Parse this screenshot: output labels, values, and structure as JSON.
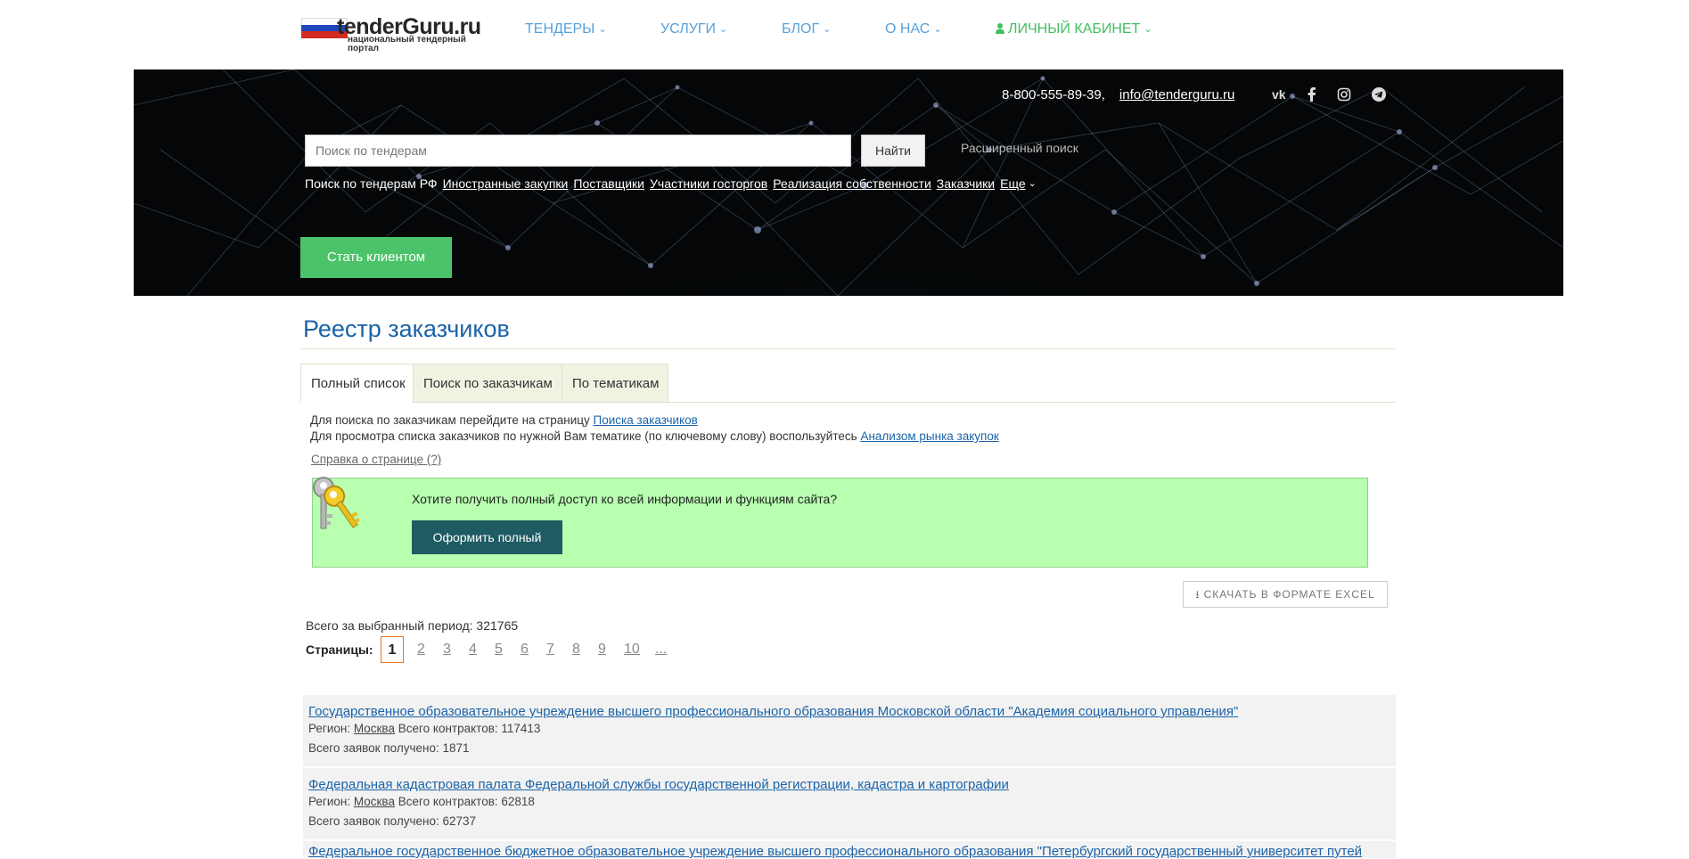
{
  "header": {
    "logo_text": "tenderGuru.ru",
    "logo_sub": "национальный тендерный портал",
    "nav": [
      {
        "label": "ТЕНДЕРЫ"
      },
      {
        "label": "УСЛУГИ"
      },
      {
        "label": "БЛОГ"
      },
      {
        "label": "О НАС"
      },
      {
        "label": "ЛИЧНЫЙ КАБИНЕТ"
      }
    ]
  },
  "hero": {
    "phone": "8-800-555-89-39,",
    "email": "info@tenderguru.ru",
    "social_icons": [
      "vk-icon",
      "facebook-icon",
      "instagram-icon",
      "telegram-icon"
    ],
    "search_placeholder": "Поиск по тендерам",
    "search_button": "Найти",
    "advanced_search": "Расширенный поиск",
    "quick_prefix": "Поиск по тендерам РФ",
    "quick_links": [
      "Иностранные закупки",
      "Поставщики",
      "Участники госторгов",
      "Реализация собственности",
      "Заказчики",
      "Еще"
    ],
    "client_button": "Стать клиентом"
  },
  "main": {
    "title": "Реестр заказчиков",
    "tabs": [
      {
        "label": "Полный список",
        "active": true
      },
      {
        "label": "Поиск по заказчикам",
        "active": false
      },
      {
        "label": "По тематикам",
        "active": false
      }
    ],
    "info_line1_text": "Для поиска по заказчикам перейдите на страницу",
    "info_line1_link": "Поиска заказчиков",
    "info_line2_text": "Для просмотра списка заказчиков по нужной Вам тематике (по ключевому слову) воспользуйтесь",
    "info_line2_link": "Анализом рынка закупок",
    "help_link": "Справка о странице (?)",
    "promo_text": "Хотите получить полный доступ ко всей информации и функциям сайта?",
    "promo_button": "Оформить полный доступ",
    "excel_button": "СКАЧАТЬ В ФОРМАТЕ EXCEL",
    "total_text": "Всего за выбранный период: 321765",
    "pager_label": "Страницы:",
    "pages": [
      "1",
      "2",
      "3",
      "4",
      "5",
      "6",
      "7",
      "8",
      "9",
      "10",
      "..."
    ],
    "current_page": "1",
    "results": [
      {
        "title": "Государственное образовательное учреждение высшего профессионального образования Московской области \"Академия социального управления\"",
        "region_label": "Регион:",
        "region": "Москва",
        "contracts": "Всего контрактов: 117413",
        "applications": "Всего заявок получено: 1871"
      },
      {
        "title": "Федеральная кадастровая палата Федеральной службы государственной регистрации, кадастра и картографии",
        "region_label": "Регион:",
        "region": "Москва",
        "contracts": "Всего контрактов: 62818",
        "applications": "Всего заявок получено: 62737"
      },
      {
        "title": "Федеральное государственное бюджетное образовательное учреждение высшего профессионального образования \"Петербургский государственный университет путей"
      }
    ]
  }
}
